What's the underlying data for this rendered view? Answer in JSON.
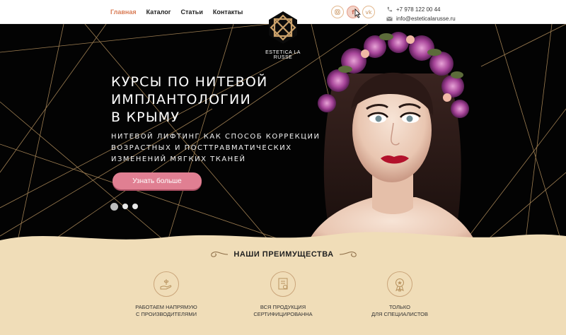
{
  "nav": [
    {
      "label": "Главная",
      "active": true
    },
    {
      "label": "Каталог",
      "active": false
    },
    {
      "label": "Статьи",
      "active": false
    },
    {
      "label": "Контакты",
      "active": false
    }
  ],
  "brand": {
    "name": "ESTETICA LA RUSSE"
  },
  "social": [
    {
      "icon": "instagram-icon"
    },
    {
      "icon": "facebook-icon",
      "glyph": "f"
    },
    {
      "icon": "vk-icon",
      "glyph": "vk"
    }
  ],
  "contacts": {
    "phone": "+7 978 122 00 44",
    "email": "info@esteticalarusse.ru"
  },
  "hero": {
    "title_lines": [
      "КУРСЫ ПО НИТЕВОЙ",
      "ИМПЛАНТОЛОГИИ",
      "В КРЫМУ"
    ],
    "subtitle_lines": [
      "НИТЕВОЙ ЛИФТИНГ КАК СПОСОБ КОРРЕКЦИИ",
      "ВОЗРАСТНЫХ И ПОСТТРАВМАТИЧЕСКИХ",
      "ИЗМЕНЕНИЙ МЯГКИХ ТКАНЕЙ"
    ],
    "cta_label": "Узнать больше",
    "slides": 3,
    "active_slide": 1
  },
  "advantages": {
    "title": "НАШИ ПРЕИМУЩЕСТВА",
    "items": [
      {
        "icon": "hand-plant-icon",
        "line1": "РАБОТАЕМ НАПРЯМУЮ",
        "line2": "С ПРОИЗВОДИТЕЛЯМИ"
      },
      {
        "icon": "certificate-icon",
        "line1": "ВСЯ ПРОДУКЦИЯ",
        "line2": "СЕРТИФИЦИРОВАННА"
      },
      {
        "icon": "award-medal-icon",
        "line1": "ТОЛЬКО",
        "line2": "ДЛЯ СПЕЦИАЛИСТОВ"
      }
    ]
  },
  "colors": {
    "accent": "#e07f92",
    "nav_active": "#d97d57",
    "gold": "#c9a06a",
    "beige": "#f0ddb8",
    "hero_bg": "#030303"
  }
}
